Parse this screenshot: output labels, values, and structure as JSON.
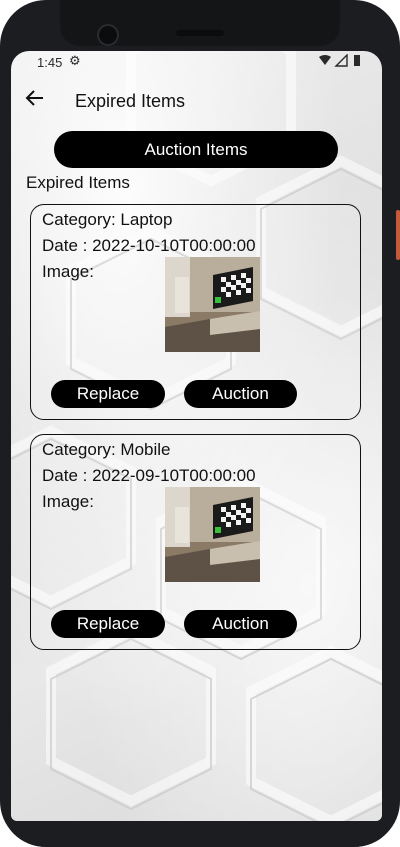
{
  "status_bar": {
    "time": "1:45",
    "settings_icon": "gear-icon",
    "right_icons": "▾◢▮"
  },
  "app_bar": {
    "back_icon": "arrow-left-icon",
    "title": "Expired Items"
  },
  "auction_items_button": "Auction Items",
  "section_label": "Expired Items",
  "items": [
    {
      "category_label": "Category: Laptop",
      "date_label": "Date : 2022-10-10T00:00:00",
      "image_label": "Image:",
      "replace_label": "Replace",
      "auction_label": "Auction"
    },
    {
      "category_label": "Category: Mobile",
      "date_label": "Date : 2022-09-10T00:00:00",
      "image_label": "Image:",
      "replace_label": "Replace",
      "auction_label": "Auction"
    }
  ],
  "colors": {
    "button_bg": "#000000",
    "button_text": "#ffffff",
    "card_border": "#111111"
  }
}
